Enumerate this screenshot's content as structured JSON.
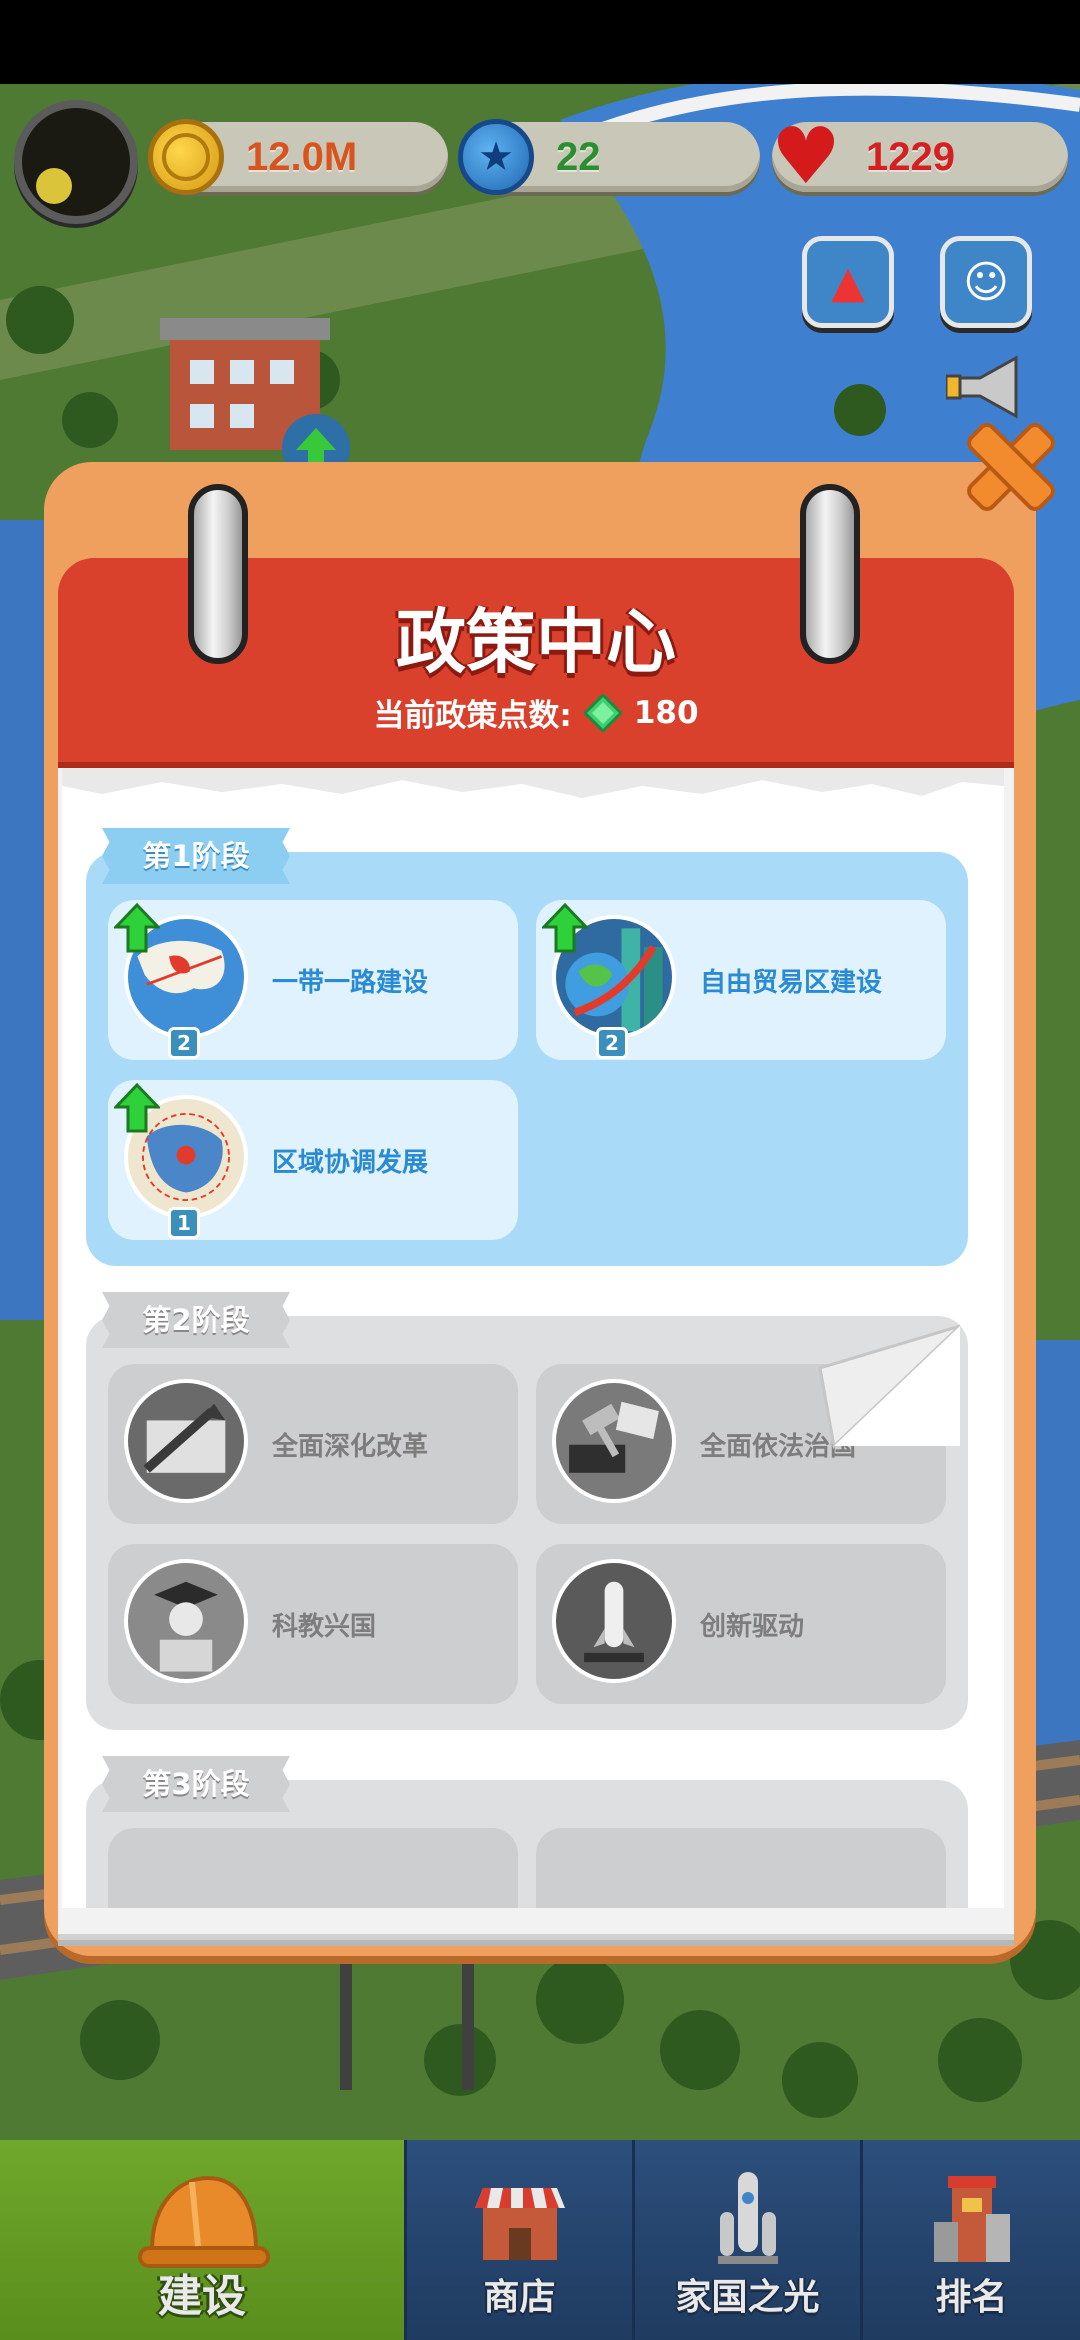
{
  "hud": {
    "coins": "12.0M",
    "stars": "22",
    "hearts": "1229"
  },
  "policy": {
    "title": "政策中心",
    "points_label": "当前政策点数:",
    "points_value": "180",
    "stages": [
      {
        "name": "第1阶段",
        "items": [
          {
            "label": "一带一路建设",
            "level": "2"
          },
          {
            "label": "自由贸易区建设",
            "level": "2"
          },
          {
            "label": "区域协调发展",
            "level": "1"
          }
        ]
      },
      {
        "name": "第2阶段",
        "items": [
          {
            "label": "全面深化改革"
          },
          {
            "label": "全面依法治国"
          },
          {
            "label": "科教兴国"
          },
          {
            "label": "创新驱动"
          }
        ]
      },
      {
        "name": "第3阶段"
      }
    ]
  },
  "nav": {
    "build": "建设",
    "shop": "商店",
    "home_light": "家国之光",
    "rank": "排名"
  },
  "colors": {
    "modal_orange": "#f0a05e",
    "header_red": "#d9412c",
    "stage_active_blue": "#a9dbf8",
    "stage_locked_gray": "#dedfe1",
    "nav_active_green": "#6fa82c",
    "nav_blue": "#2c4f7c"
  }
}
